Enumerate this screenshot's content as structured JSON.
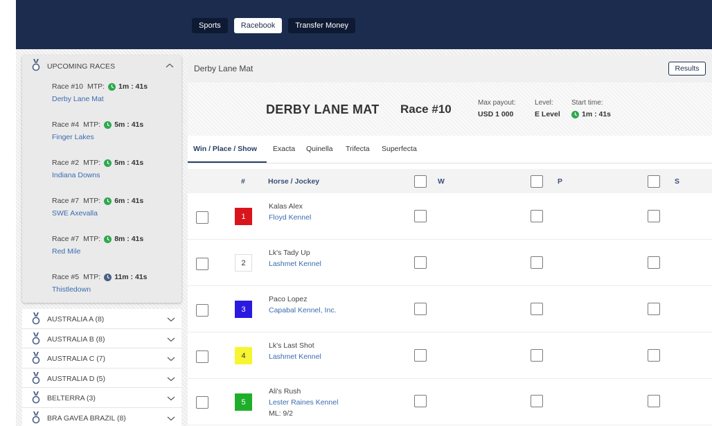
{
  "nav": {
    "items": [
      {
        "label": "Sports",
        "active": false
      },
      {
        "label": "Racebook",
        "active": true
      },
      {
        "label": "Transfer Money",
        "active": false
      }
    ]
  },
  "upcoming": {
    "title": "UPCOMING RACES",
    "mtp_label": "MTP:",
    "races": [
      {
        "race": "Race #10",
        "mtp": "1m : 41s",
        "track": "Derby Lane Mat",
        "clock_color": "#2fa84f"
      },
      {
        "race": "Race #4",
        "mtp": "5m : 41s",
        "track": "Finger Lakes",
        "clock_color": "#2fa84f"
      },
      {
        "race": "Race #2",
        "mtp": "5m : 41s",
        "track": "Indiana Downs",
        "clock_color": "#2fa84f"
      },
      {
        "race": "Race #7",
        "mtp": "6m : 41s",
        "track": "SWE Axevalla",
        "clock_color": "#2fa84f"
      },
      {
        "race": "Race #7",
        "mtp": "8m : 41s",
        "track": "Red Mile",
        "clock_color": "#2fa84f"
      },
      {
        "race": "Race #5",
        "mtp": "11m : 41s",
        "track": "Thistledown",
        "clock_color": "#4a5f86"
      }
    ]
  },
  "regions": [
    "AUSTRALIA A (8)",
    "AUSTRALIA B (8)",
    "AUSTRALIA C (7)",
    "AUSTRALIA D (5)",
    "BELTERRA (3)",
    "BRA GAVEA BRAZIL (8)"
  ],
  "panel": {
    "title": "Derby Lane Mat",
    "results_label": "Results",
    "track_heading": "DERBY LANE MAT",
    "race_heading": "Race #10",
    "max_payout_label": "Max payout:",
    "max_payout_value": "USD 1 000",
    "level_label": "Level:",
    "level_value": "E Level",
    "start_label": "Start time:",
    "start_value": "1m : 41s"
  },
  "tabs": [
    "Win / Place / Show",
    "Exacta",
    "Quinella",
    "Trifecta",
    "Superfecta"
  ],
  "table": {
    "headers": {
      "num": "#",
      "horse": "Horse / Jockey",
      "w": "W",
      "p": "P",
      "s": "S"
    },
    "rows": [
      {
        "num": "1",
        "horse": "Kalas Alex",
        "kennel": "Floyd Kennel",
        "ml": "",
        "bg": "#d9151b",
        "fg": "#ffffff"
      },
      {
        "num": "2",
        "horse": "Lk's Tady Up",
        "kennel": "Lashmet Kennel",
        "ml": "",
        "bg": "#ffffff",
        "fg": "#333333"
      },
      {
        "num": "3",
        "horse": "Paco Lopez",
        "kennel": "Capabal Kennel, Inc.",
        "ml": "",
        "bg": "#2a1ae0",
        "fg": "#ffffff"
      },
      {
        "num": "4",
        "horse": "Lk's Last Shot",
        "kennel": "Lashmet Kennel",
        "ml": "",
        "bg": "#f7f532",
        "fg": "#333333"
      },
      {
        "num": "5",
        "horse": "Ali's Rush",
        "kennel": "Lester Raines Kennel",
        "ml": "ML: 9/2",
        "bg": "#1fae2a",
        "fg": "#ffffff"
      }
    ]
  }
}
